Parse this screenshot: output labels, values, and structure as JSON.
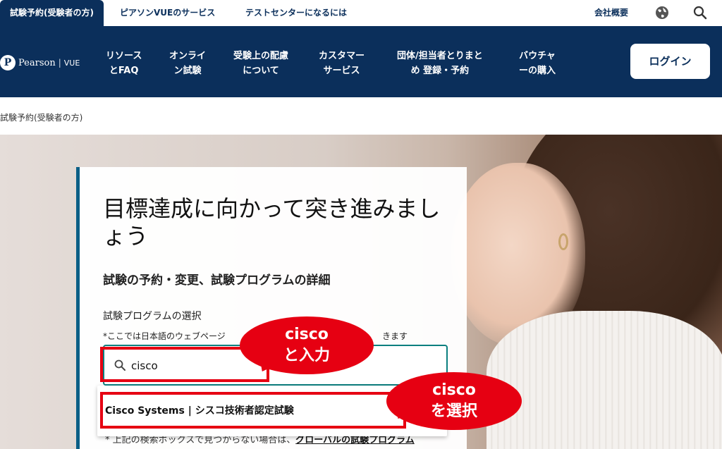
{
  "topbar": {
    "tabs": [
      "試験予約(受験者の方)",
      "ピアソンVUEのサービス",
      "テストセンターになるには"
    ],
    "right_link": "会社概要",
    "icons": [
      "globe-icon",
      "search-icon"
    ]
  },
  "nav": {
    "logo_word": "Pearson",
    "logo_sep": "|",
    "logo_vue": "VUE",
    "items": [
      {
        "line1": "リソース",
        "line2": "とFAQ"
      },
      {
        "line1": "オンライ",
        "line2": "ン試験"
      },
      {
        "line1": "受験上の配慮",
        "line2": "について"
      },
      {
        "line1": "カスタマー",
        "line2": "サービス"
      },
      {
        "line1": "団体/担当者とりまと",
        "line2": "め 登録・予約"
      },
      {
        "line1": "バウチャ",
        "line2": "ーの購入"
      }
    ],
    "login": "ログイン"
  },
  "breadcrumb": "試験予約(受験者の方)",
  "card": {
    "title": "目標達成に向かって突き進みましょう",
    "subtitle": "試験の予約・変更、試験プログラムの詳細",
    "label": "試験プログラムの選択",
    "note_start": "*ここでは日本語のウェブページ",
    "note_end": "きます",
    "input_value": "cisco",
    "bottom_start": "* 上記の検索ボックスで見つからない場合は、",
    "bottom_link": "グローバルの試験プログラム"
  },
  "dropdown": {
    "option": "Cisco Systems | シスコ技術者認定試験"
  },
  "annotations": {
    "bubble1_line1": "cisco",
    "bubble1_line2": "と入力",
    "bubble2_line1": "cisco",
    "bubble2_line2": "を選択",
    "color": "#e60012"
  },
  "colors": {
    "brand_navy": "#0b2f5b",
    "accent_teal": "#0b7f7f"
  }
}
